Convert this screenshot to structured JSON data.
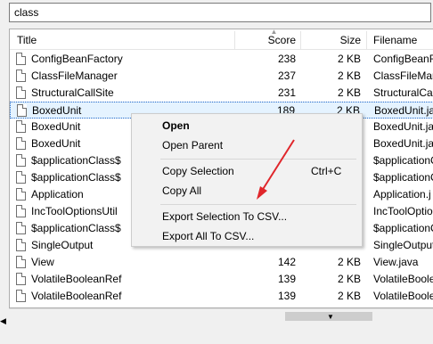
{
  "search": {
    "value": "class"
  },
  "columns": {
    "title": "Title",
    "score": "Score",
    "size": "Size",
    "filename": "Filename"
  },
  "rows": [
    {
      "title": "ConfigBeanFactory",
      "score": "238",
      "size": "2 KB",
      "filename": "ConfigBeanF"
    },
    {
      "title": "ClassFileManager",
      "score": "237",
      "size": "2 KB",
      "filename": "ClassFileMan"
    },
    {
      "title": "StructuralCallSite",
      "score": "231",
      "size": "2 KB",
      "filename": "StructuralCal"
    },
    {
      "title": "BoxedUnit",
      "score": "189",
      "size": "2 KB",
      "filename": "BoxedUnit.jav",
      "selected": true
    },
    {
      "title": "BoxedUnit",
      "score": "",
      "size": "",
      "filename": "BoxedUnit.jav"
    },
    {
      "title": "BoxedUnit",
      "score": "",
      "size": "",
      "filename": "BoxedUnit.jav"
    },
    {
      "title": "$applicationClass$",
      "score": "",
      "size": "",
      "filename": "$applicationC"
    },
    {
      "title": "$applicationClass$",
      "score": "",
      "size": "",
      "filename": "$applicationC"
    },
    {
      "title": "Application",
      "score": "",
      "size": "",
      "filename": "Application.j"
    },
    {
      "title": "IncToolOptionsUtil",
      "score": "",
      "size": "",
      "filename": "IncToolOption"
    },
    {
      "title": "$applicationClass$",
      "score": "",
      "size": "",
      "filename": "$applicationC"
    },
    {
      "title": "SingleOutput",
      "score": "",
      "size": "",
      "filename": "SingleOutput"
    },
    {
      "title": "View",
      "score": "142",
      "size": "2 KB",
      "filename": "View.java"
    },
    {
      "title": "VolatileBooleanRef",
      "score": "139",
      "size": "2 KB",
      "filename": "VolatileBoole"
    },
    {
      "title": "VolatileBooleanRef",
      "score": "139",
      "size": "2 KB",
      "filename": "VolatileBoole"
    }
  ],
  "context_menu": {
    "items": [
      {
        "label": "Open",
        "shortcut": ""
      },
      {
        "label": "Open Parent",
        "shortcut": ""
      },
      {
        "label": "Copy Selection",
        "shortcut": "Ctrl+C"
      },
      {
        "label": "Copy All",
        "shortcut": ""
      },
      {
        "label": "Export Selection To CSV...",
        "shortcut": ""
      },
      {
        "label": "Export All To CSV...",
        "shortcut": ""
      }
    ]
  },
  "icons": {
    "file": "file-icon",
    "sort": "sort-up-icon",
    "scroll": "scroll-down-arrow-icon",
    "left": "scroll-left-arrow-icon",
    "annotation": "red-arrow-annotation"
  },
  "colors": {
    "selection_bg": "#e5f3ff",
    "selection_border": "#1e67c9",
    "annotation": "#e0262b"
  }
}
